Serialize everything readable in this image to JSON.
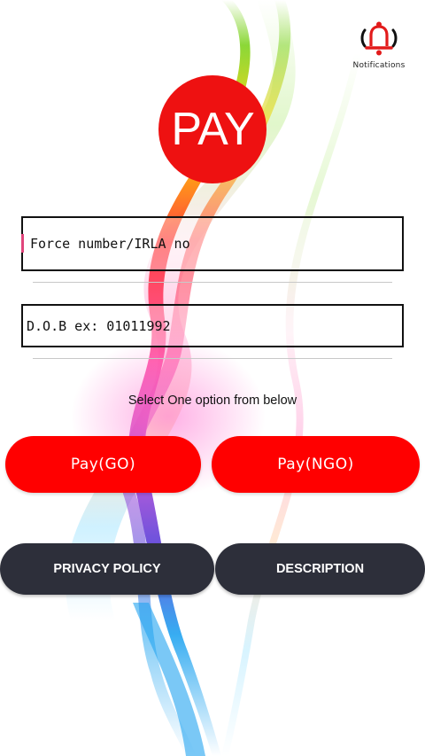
{
  "notifications": {
    "label": "Notifications",
    "icon": "bell-icon"
  },
  "logo": {
    "text": "PAY"
  },
  "form": {
    "force_number_placeholder": "Force number/IRLA no",
    "force_number_value": "",
    "dob_placeholder": "D.O.B ex: 01011992",
    "dob_value": ""
  },
  "instruction": "Select One option from below",
  "buttons": {
    "pay_go": "Pay(GO)",
    "pay_ngo": "Pay(NGO)",
    "privacy_policy": "PRIVACY POLICY",
    "description": "DESCRIPTION"
  },
  "colors": {
    "accent_red": "#ff0000",
    "dark_button": "#2d2f3a",
    "logo_red": "#ee1111"
  }
}
